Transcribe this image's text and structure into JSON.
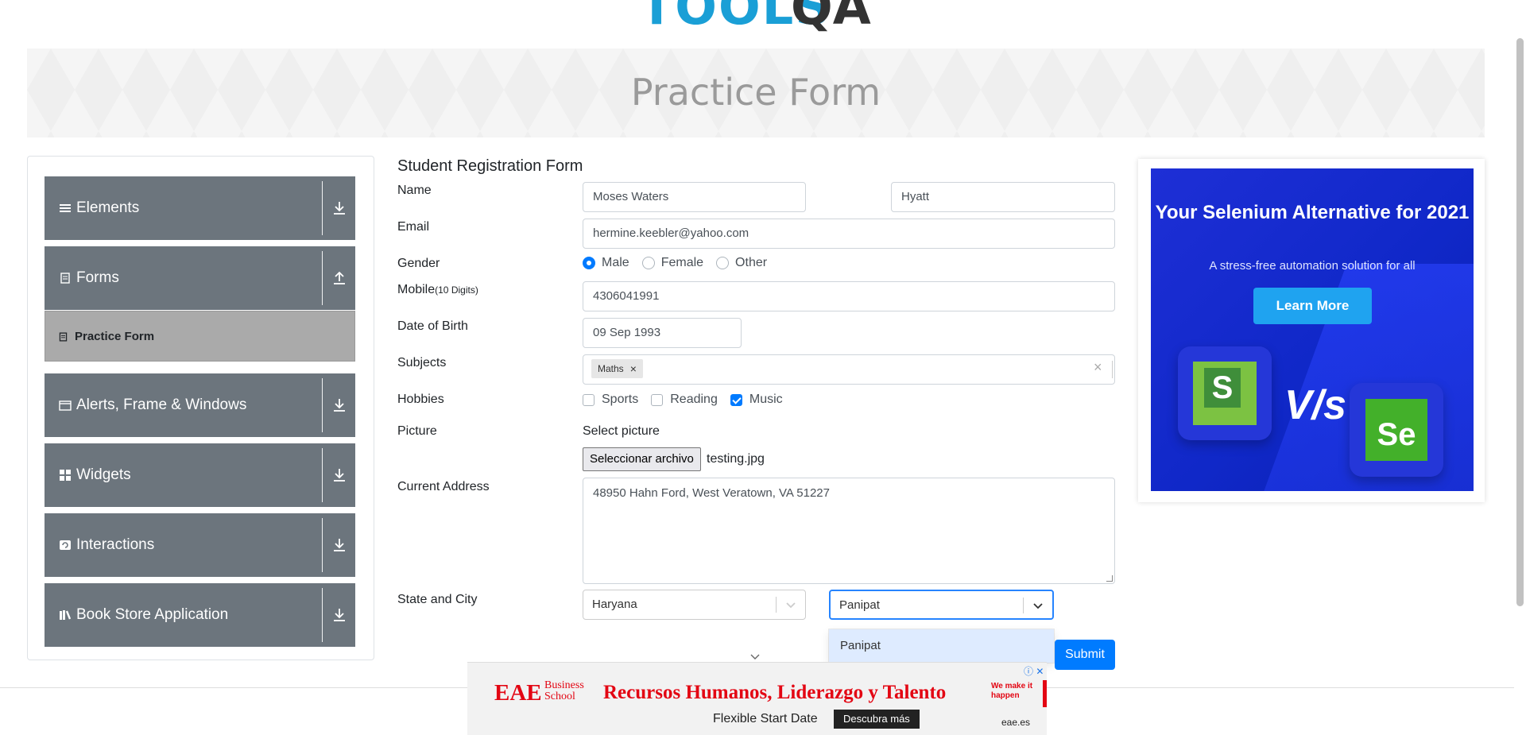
{
  "header": {
    "logo_text_tools": "TOOLS",
    "logo_text_qa": "QA"
  },
  "banner": {
    "title": "Practice Form"
  },
  "sidebar": {
    "groups": [
      {
        "label": "Elements",
        "icon": "hamburger-icon",
        "arrow": "download-icon"
      },
      {
        "label": "Forms",
        "icon": "document-icon",
        "arrow": "upload-icon"
      },
      {
        "label": "Alerts, Frame & Windows",
        "icon": "window-icon",
        "arrow": "download-icon"
      },
      {
        "label": "Widgets",
        "icon": "grid-icon",
        "arrow": "download-icon"
      },
      {
        "label": "Interactions",
        "icon": "interaction-icon",
        "arrow": "download-icon"
      },
      {
        "label": "Book Store Application",
        "icon": "books-icon",
        "arrow": "download-icon"
      }
    ],
    "active_item": {
      "label": "Practice Form"
    }
  },
  "form": {
    "title": "Student Registration Form",
    "labels": {
      "name": "Name",
      "email": "Email",
      "gender": "Gender",
      "mobile": "Mobile",
      "mobile_hint": "(10 Digits)",
      "dob": "Date of Birth",
      "subjects": "Subjects",
      "hobbies": "Hobbies",
      "picture": "Picture",
      "address": "Current Address",
      "state_city": "State and City"
    },
    "first_name": "Moses Waters",
    "last_name": "Hyatt",
    "email": "hermine.keebler@yahoo.com",
    "gender_options": [
      {
        "label": "Male",
        "checked": true
      },
      {
        "label": "Female",
        "checked": false
      },
      {
        "label": "Other",
        "checked": false
      }
    ],
    "mobile": "4306041991",
    "dob": "09 Sep 1993",
    "subjects": [
      "Maths"
    ],
    "subject_chip_remove": "×",
    "subjects_clear": "×",
    "hobbies": [
      {
        "label": "Sports",
        "checked": false
      },
      {
        "label": "Reading",
        "checked": false
      },
      {
        "label": "Music",
        "checked": true
      }
    ],
    "picture_label": "Select picture",
    "file_button": "Seleccionar archivo",
    "file_name": "testing.jpg",
    "address": "48950 Hahn Ford, West Veratown, VA 51227",
    "state": "Haryana",
    "city": "Panipat",
    "city_menu_option": "Panipat",
    "submit": "Submit"
  },
  "right_ad": {
    "headline": "Your Selenium Alternative for 2021",
    "subline": "A stress-free automation solution for all",
    "button": "Learn More",
    "vs_text": "V/s",
    "logo_left_letter": "S",
    "logo_right_letters": "Se"
  },
  "bottom_ad": {
    "brand": "EAE",
    "brand_sub": "Business School",
    "headline": "Recursos Humanos, Liderazgo y Talento",
    "tagline": "We make it happen",
    "subtext": "Flexible Start Date",
    "cta": "Descubra más",
    "domain": "eae.es",
    "close": "ⓘ ✕"
  },
  "colors": {
    "primary": "#007bff",
    "sidebar_group": "#6c757d",
    "sidebar_active": "#aaaaaa",
    "ad_red": "#e30613"
  }
}
